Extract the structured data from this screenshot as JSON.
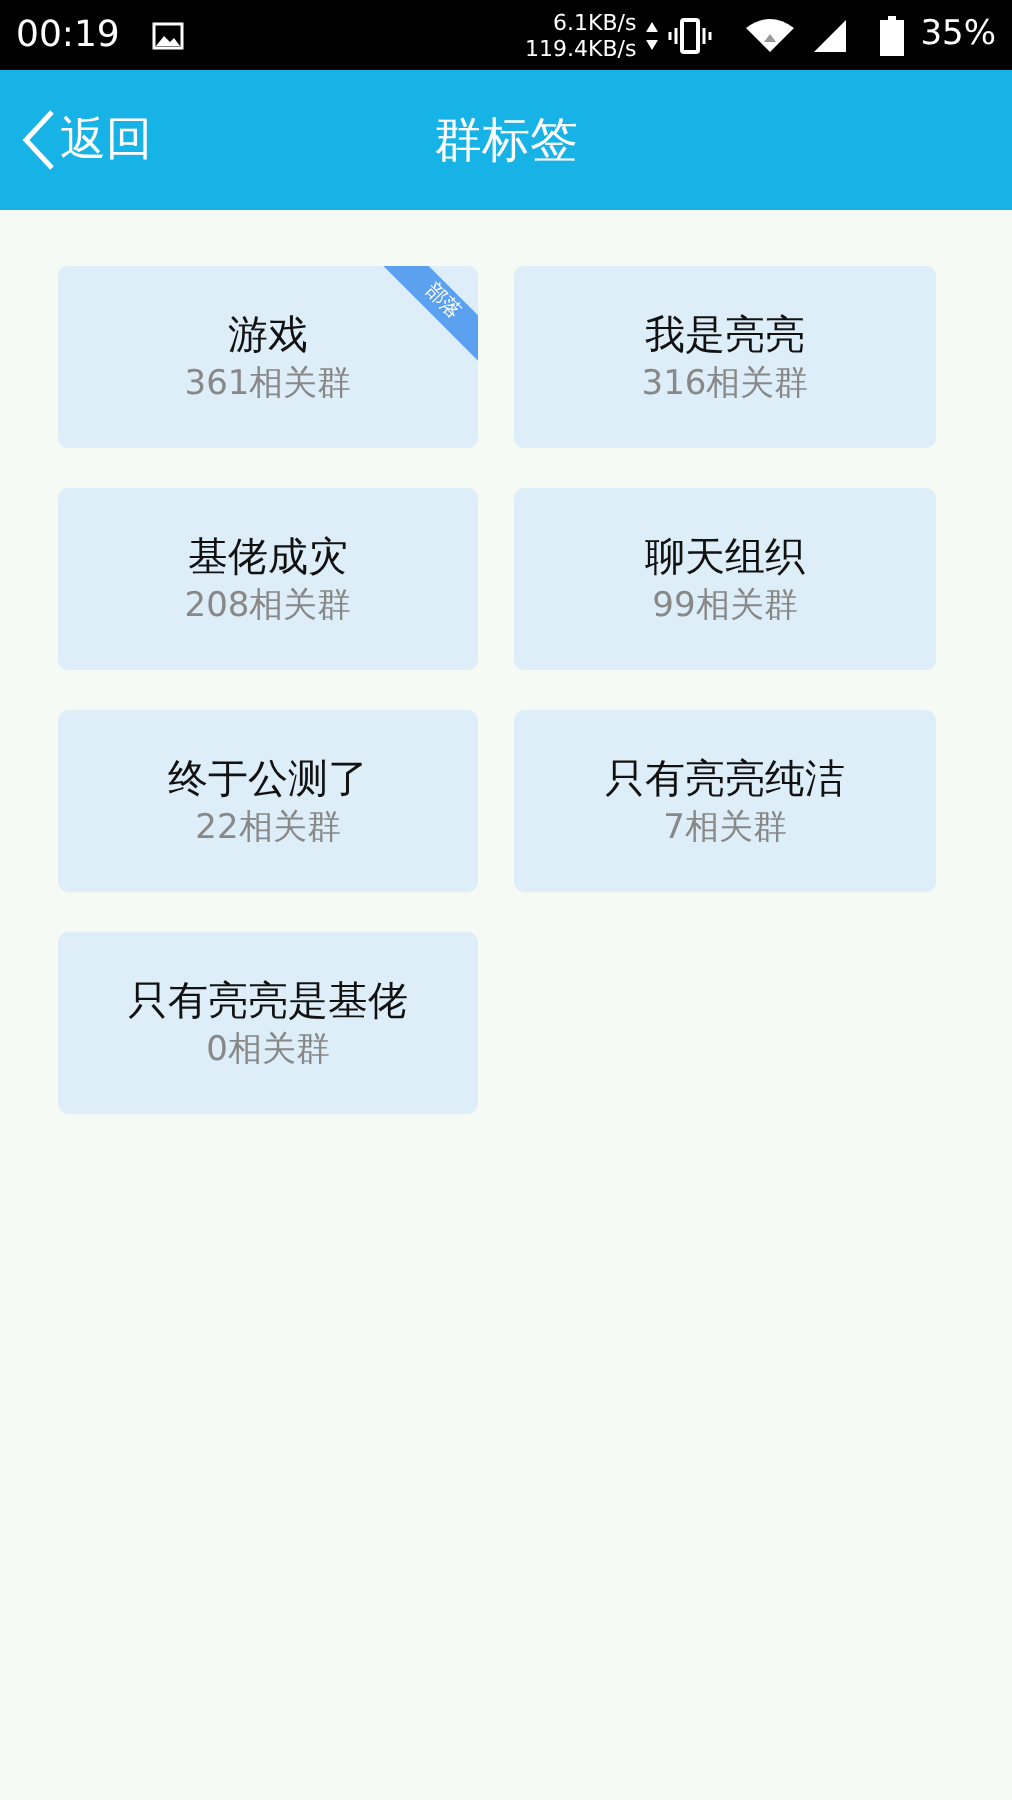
{
  "status_bar": {
    "time": "00:19",
    "upload_speed": "6.1KB/s",
    "download_speed": "119.4KB/s",
    "battery": "35%"
  },
  "header": {
    "back": "返回",
    "title": "群标签"
  },
  "tags": [
    {
      "name": "游戏",
      "count": "361相关群",
      "ribbon": "部落"
    },
    {
      "name": "我是亮亮",
      "count": "316相关群"
    },
    {
      "name": "基佬成灾",
      "count": "208相关群"
    },
    {
      "name": "聊天组织",
      "count": "99相关群"
    },
    {
      "name": "终于公测了",
      "count": "22相关群"
    },
    {
      "name": "只有亮亮纯洁",
      "count": "7相关群"
    },
    {
      "name": "只有亮亮是基佬",
      "count": "0相关群"
    }
  ]
}
